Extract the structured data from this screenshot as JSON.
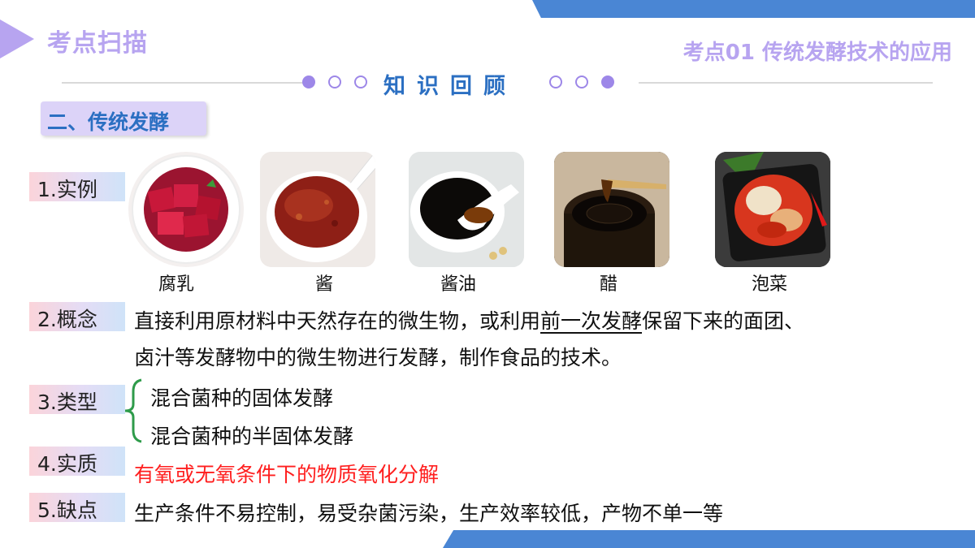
{
  "header": {
    "title": "考点扫描",
    "subtitle": "考点01  传统发酵技术的应用"
  },
  "section_title": "知识回顾",
  "section_badge": "二、传统发酵",
  "rows": {
    "example_label": "1.实例",
    "concept_label": "2.概念",
    "type_label": "3.类型",
    "essence_label": "4.实质",
    "drawback_label": "5.缺点"
  },
  "examples": [
    {
      "caption": "腐乳"
    },
    {
      "caption": "酱"
    },
    {
      "caption": "酱油"
    },
    {
      "caption": "醋"
    },
    {
      "caption": "泡菜"
    }
  ],
  "concept": {
    "line1_before": "直接利用原材料中天然存在的微生物，或利用",
    "line1_underlined": "前一次发酵",
    "line1_after": "保留下来的面团、",
    "line2": "卤汁等发酵物中的微生物进行发酵，制作食品的技术。"
  },
  "types": [
    "混合菌种的固体发酵",
    "混合菌种的半固体发酵"
  ],
  "essence": "有氧或无氧条件下的物质氧化分解",
  "drawback": "生产条件不易控制，易受杂菌污染，生产效率较低，产物不单一等",
  "colors": {
    "accent_purple": "#b7a4f0",
    "accent_blue": "#2b6fc2",
    "corner_blue": "#4a86d4",
    "highlight_red": "#ff1f1f"
  }
}
